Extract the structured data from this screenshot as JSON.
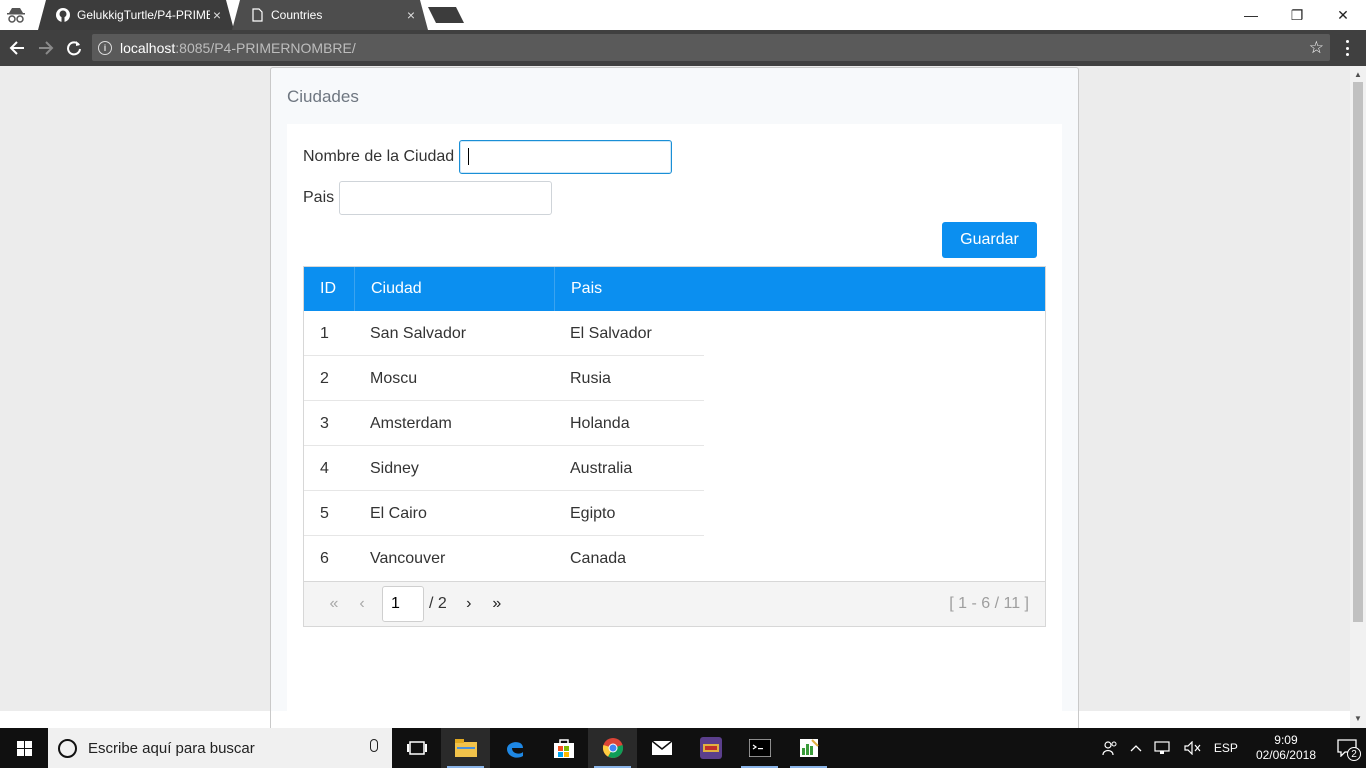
{
  "browser": {
    "tabs": [
      {
        "title": "GelukkigTurtle/P4-PRIME",
        "icon": "github-icon",
        "close": "×"
      },
      {
        "title": "Countries",
        "icon": "page-icon",
        "close": "×"
      }
    ],
    "url_host": "localhost",
    "url_path": ":8085/P4-PRIMERNOMBRE/",
    "window_controls": {
      "minimize": "—",
      "restore": "❐",
      "close": "✕"
    }
  },
  "page": {
    "panel_title": "Ciudades",
    "form": {
      "city_label": "Nombre de la Ciudad",
      "city_value": "",
      "country_label": "Pais",
      "country_value": "",
      "save_button": "Guardar"
    },
    "table": {
      "headers": {
        "id": "ID",
        "city": "Ciudad",
        "country": "Pais"
      },
      "rows": [
        {
          "id": "1",
          "city": "San Salvador",
          "country": "El Salvador"
        },
        {
          "id": "2",
          "city": "Moscu",
          "country": "Rusia"
        },
        {
          "id": "3",
          "city": "Amsterdam",
          "country": "Holanda"
        },
        {
          "id": "4",
          "city": "Sidney",
          "country": "Australia"
        },
        {
          "id": "5",
          "city": "El Cairo",
          "country": "Egipto"
        },
        {
          "id": "6",
          "city": "Vancouver",
          "country": "Canada"
        }
      ]
    },
    "paginator": {
      "first": "«",
      "prev": "‹",
      "current_page": "1",
      "total_pages": "/ 2",
      "next": "›",
      "last": "»",
      "summary": "[ 1 - 6 / 11 ]"
    }
  },
  "taskbar": {
    "search_placeholder": "Escribe aquí para buscar",
    "language": "ESP",
    "time": "9:09",
    "date": "02/06/2018",
    "notification_count": "2",
    "apps": [
      "task-view-icon",
      "file-explorer-icon",
      "edge-icon",
      "store-icon",
      "chrome-icon",
      "mail-icon",
      "game-icon",
      "terminal-icon",
      "editor-icon"
    ]
  },
  "colors": {
    "accent": "#0b8ff0",
    "toolbar": "#404040",
    "taskbar": "#101010"
  }
}
